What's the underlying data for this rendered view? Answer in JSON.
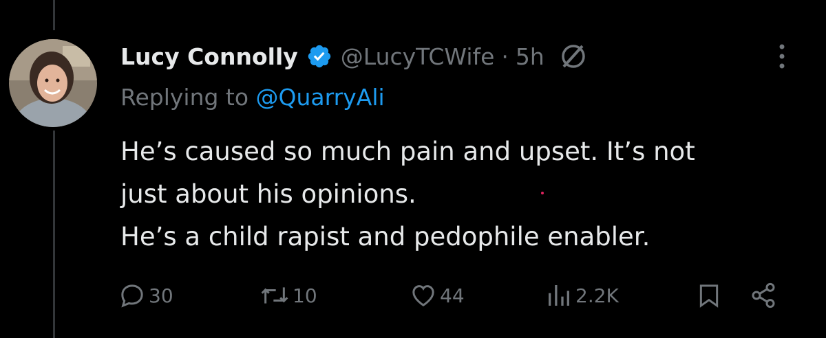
{
  "tweet": {
    "author_name": "Lucy Connolly",
    "handle": "@LucyTCWife",
    "separator": "·",
    "time": "5h",
    "replying_prefix": "Replying to",
    "replying_to": "@QuarryAli",
    "text_lines": [
      "He’s caused so much pain and upset. It’s not",
      "just about his opinions.",
      "He’s a child rapist and pedophile enabler."
    ]
  },
  "actions": {
    "replies": "30",
    "reposts": "10",
    "likes": "44",
    "views": "2.2K"
  },
  "icons": {
    "verified": "verified-badge-icon",
    "grok": "grok-icon",
    "more": "more-vertical-icon",
    "reply": "reply-icon",
    "repost": "repost-icon",
    "like": "heart-icon",
    "views": "views-bar-chart-icon",
    "bookmark": "bookmark-icon",
    "share": "share-icon"
  },
  "colors": {
    "background": "#000000",
    "text": "#e7e9ea",
    "muted": "#71767b",
    "accent": "#1d9bf0"
  }
}
